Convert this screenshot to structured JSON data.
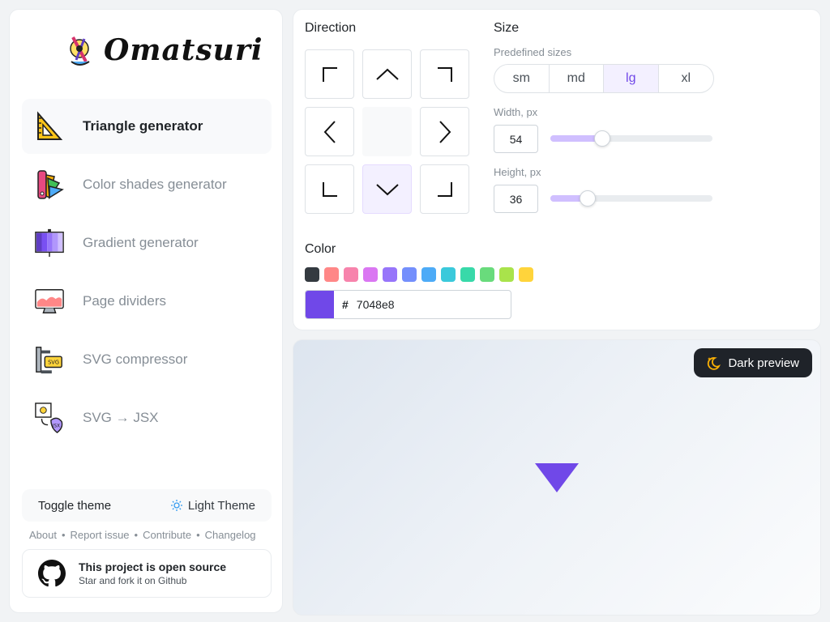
{
  "logo": {
    "text": "Omatsuri"
  },
  "nav": [
    {
      "label": "Triangle generator",
      "icon": "ruler-triangle-icon",
      "active": true
    },
    {
      "label": "Color shades generator",
      "icon": "color-palette-icon",
      "active": false
    },
    {
      "label": "Gradient generator",
      "icon": "gradient-icon",
      "active": false
    },
    {
      "label": "Page dividers",
      "icon": "monitor-icon",
      "active": false
    },
    {
      "label": "SVG compressor",
      "icon": "svg-clamp-icon",
      "active": false
    },
    {
      "label": "SVG → JSX",
      "icon": "svg-to-jsx-icon",
      "active": false
    }
  ],
  "theme": {
    "toggle_label": "Toggle theme",
    "current": "Light Theme"
  },
  "footer": {
    "links": [
      "About",
      "Report issue",
      "Contribute",
      "Changelog"
    ],
    "separator": "•"
  },
  "github": {
    "title": "This project is open source",
    "subtitle": "Star and fork it on Github"
  },
  "direction": {
    "title": "Direction",
    "options": [
      "top-left",
      "top",
      "top-right",
      "left",
      "",
      "right",
      "bottom-left",
      "bottom",
      "bottom-right"
    ],
    "selected": "bottom"
  },
  "size": {
    "title": "Size",
    "predefined_label": "Predefined sizes",
    "options": [
      "sm",
      "md",
      "lg",
      "xl"
    ],
    "selected": "lg",
    "width_label": "Width, px",
    "width_value": "54",
    "width_fraction": 0.27,
    "height_label": "Height, px",
    "height_value": "36",
    "height_fraction": 0.18
  },
  "color": {
    "title": "Color",
    "swatches": [
      "#343a40",
      "#ff8787",
      "#f783ac",
      "#da77f2",
      "#9775fa",
      "#748ffc",
      "#4dabf7",
      "#3bc9db",
      "#38d9a9",
      "#69db7c",
      "#a9e34b",
      "#ffd43b"
    ],
    "hash": "#",
    "value": "7048e8",
    "current": "#7048e8"
  },
  "preview": {
    "dark_button_label": "Dark preview"
  }
}
